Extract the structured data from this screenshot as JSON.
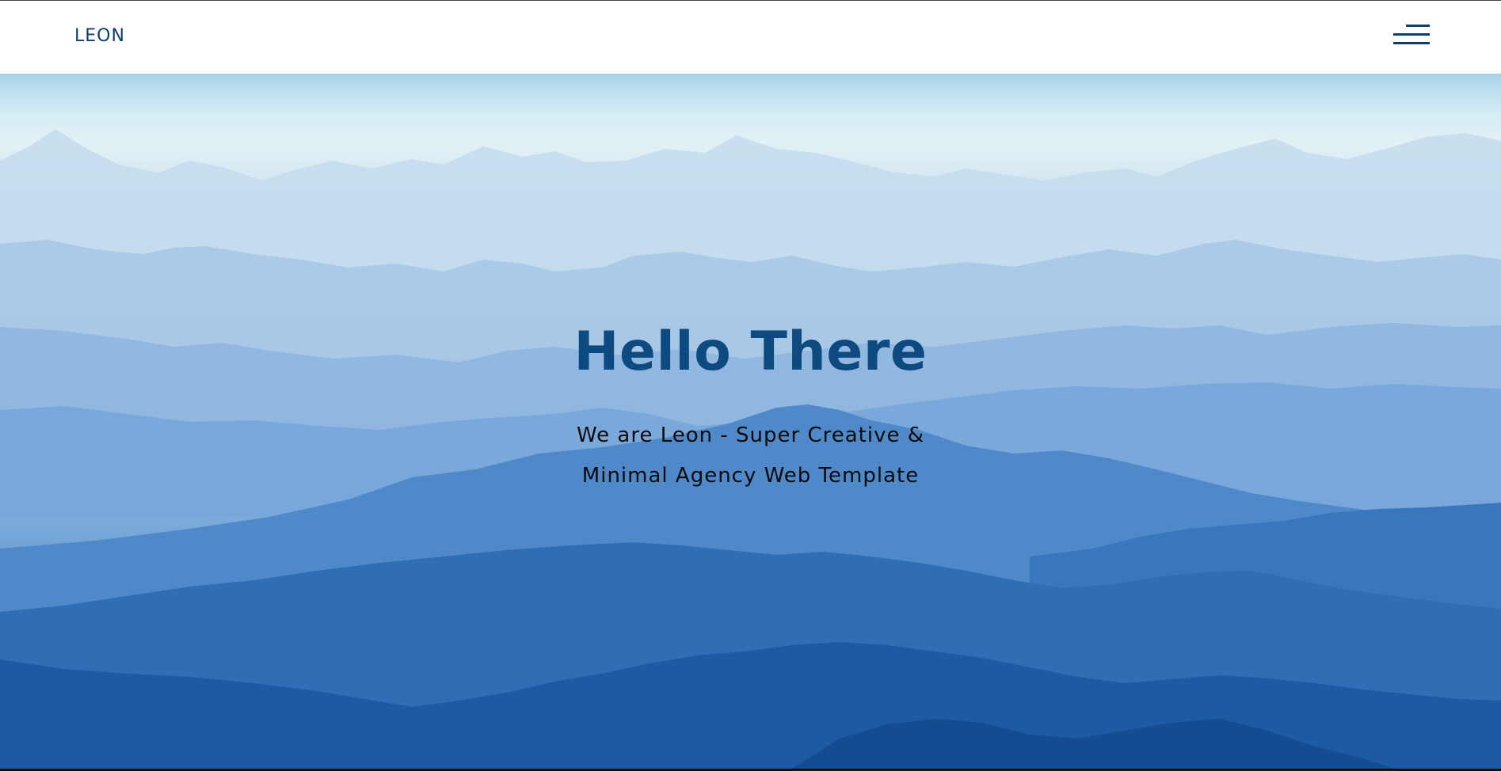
{
  "header": {
    "brand": "LEON",
    "menu_icon": "hamburger-menu-icon"
  },
  "hero": {
    "background": "blue-mountain-ranges-photo",
    "title": "Hello There",
    "subtitle_line1": "We are Leon - Super Creative &",
    "subtitle_line2": "Minimal Agency Web Template"
  },
  "colors": {
    "brand": "#0b3f72",
    "title": "#0d4a80",
    "subtitle": "#0a0a0a",
    "sky": "#d6eef5",
    "mountain_dark": "#1b5aa3"
  }
}
